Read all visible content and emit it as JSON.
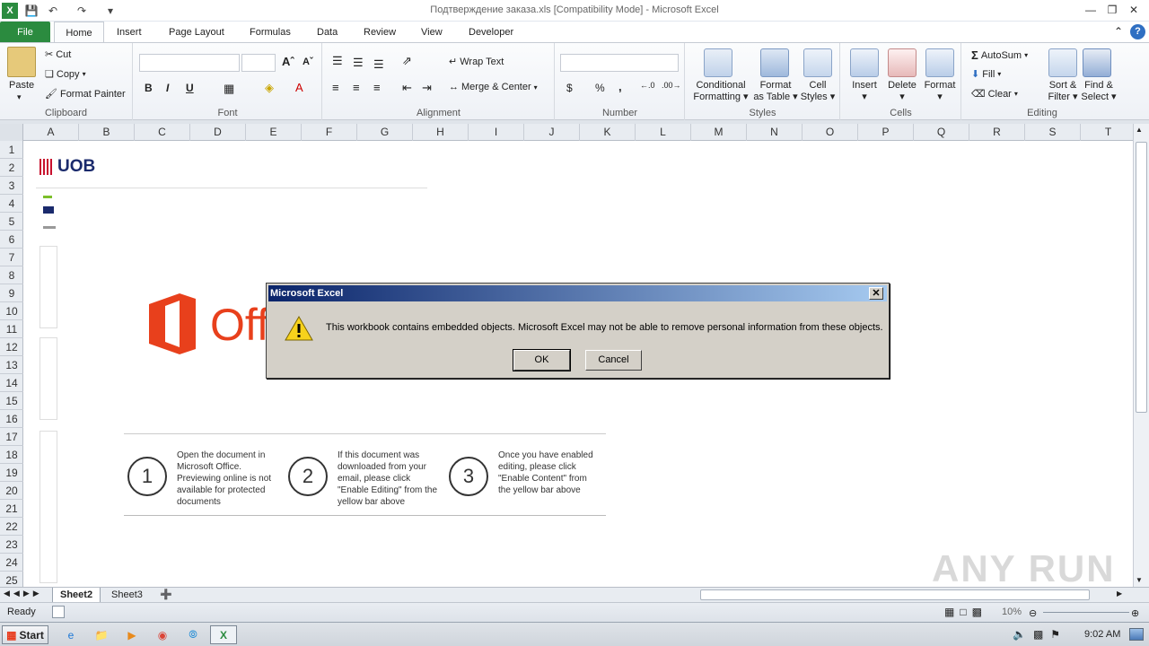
{
  "window": {
    "title": "Подтверждение заказа.xls  [Compatibility Mode]  -  Microsoft Excel"
  },
  "tabs": {
    "file": "File",
    "home": "Home",
    "insert": "Insert",
    "page_layout": "Page Layout",
    "formulas": "Formulas",
    "data": "Data",
    "review": "Review",
    "view": "View",
    "developer": "Developer"
  },
  "clipboard": {
    "paste": "Paste",
    "cut": "Cut",
    "copy": "Copy",
    "format_painter": "Format Painter",
    "label": "Clipboard"
  },
  "font": {
    "label": "Font",
    "bold": "B",
    "italic": "I",
    "underline": "U"
  },
  "alignment": {
    "wrap_text": "Wrap Text",
    "merge_center": "Merge & Center",
    "label": "Alignment"
  },
  "number": {
    "label": "Number",
    "currency": "$",
    "percent": "%",
    "comma": ","
  },
  "styles": {
    "conditional_1": "Conditional",
    "conditional_2": "Formatting",
    "format_table_1": "Format",
    "format_table_2": "as Table",
    "cell_styles_1": "Cell",
    "cell_styles_2": "Styles",
    "label": "Styles"
  },
  "cells": {
    "insert": "Insert",
    "delete": "Delete",
    "format": "Format",
    "label": "Cells"
  },
  "editing": {
    "autosum": "AutoSum",
    "fill": "Fill",
    "clear": "Clear",
    "sort_1": "Sort &",
    "sort_2": "Filter",
    "find_1": "Find &",
    "find_2": "Select",
    "label": "Editing"
  },
  "columns": [
    "A",
    "B",
    "C",
    "D",
    "E",
    "F",
    "G",
    "H",
    "I",
    "J",
    "K",
    "L",
    "M",
    "N",
    "O",
    "P",
    "Q",
    "R",
    "S",
    "T"
  ],
  "rows": [
    "1",
    "2",
    "3",
    "4",
    "5",
    "6",
    "7",
    "8",
    "9",
    "10",
    "11",
    "12",
    "13",
    "14",
    "15",
    "16",
    "17",
    "18",
    "19",
    "20",
    "21",
    "22",
    "23",
    "24",
    "25"
  ],
  "sheet_image": {
    "bank_logo": "UOB",
    "office_text": "Off",
    "steps": [
      {
        "num": "1",
        "text": "Open the document in Microsoft Office. Previewing online is not available for protected documents"
      },
      {
        "num": "2",
        "text": "If this document was downloaded from your email, please click \"Enable Editing\" from the yellow bar above"
      },
      {
        "num": "3",
        "text": "Once you have enabled editing, please click \"Enable Content\" from the yellow bar above"
      }
    ]
  },
  "sheets": {
    "sheet2": "Sheet2",
    "sheet3": "Sheet3"
  },
  "status": {
    "ready": "Ready",
    "zoom": "10%"
  },
  "taskbar": {
    "start": "Start",
    "time": "9:02 AM"
  },
  "dialog": {
    "title": "Microsoft Excel",
    "message": "This workbook contains embedded objects. Microsoft Excel may not be able to remove personal information from these objects.",
    "ok": "OK",
    "cancel": "Cancel"
  },
  "watermark": "ANY RUN"
}
